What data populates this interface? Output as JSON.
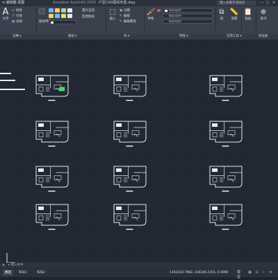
{
  "titlebar": {
    "menu": "≡  编辑器  视图",
    "app_title": "Autodesk AutoCAD 2020",
    "file_name": "户型CAD图纸布置.dwg",
    "search_placeholder": "键入关键字或短语",
    "minimize": "—",
    "maximize": "□",
    "close": "✕"
  },
  "ribbon": {
    "panels": {
      "annotation": "注释 ▾",
      "layers": "图层 ▾",
      "block": "块 ▾",
      "properties": "特性 ▾",
      "utilities": "实用工具 ▾",
      "clipboard": "剪贴板"
    },
    "text_button": "文字",
    "text_glyph": "A",
    "annotation_items": [
      "线性",
      "引线",
      "表格"
    ],
    "layers_items": [
      "图层特性",
      "置为当前",
      "匹配图层"
    ],
    "insert_button": "插入",
    "block_items": [
      "创建",
      "编辑",
      "编辑属性"
    ],
    "match_button": "特性\n匹配",
    "properties_values": {
      "color": "ByLayer",
      "linetype": "ByLayer",
      "lineweight": "ByLayer"
    },
    "group_button": "组",
    "measure_button": "测量",
    "paste_button": "粘贴",
    "base_button": "基点"
  },
  "drawing": {
    "sheets": [
      {
        "id": "a1"
      },
      {
        "id": "a2"
      },
      {
        "id": "a3"
      },
      {
        "id": "b1"
      },
      {
        "id": "b2"
      },
      {
        "id": "b3"
      },
      {
        "id": "c1"
      },
      {
        "id": "c2"
      },
      {
        "id": "c3"
      },
      {
        "id": "d1"
      },
      {
        "id": "d2"
      },
      {
        "id": "d3"
      }
    ],
    "selection_color": "#4cd964",
    "line_color": "#e8ecf2",
    "grid_color": "#2b3241"
  },
  "command_line": {
    "close_icon": "✕",
    "prompt": "▸ 键入命令"
  },
  "status": {
    "tabs": [
      "模型",
      "布局1",
      "布局2"
    ],
    "coordinates": "1162210.7982, 216246.2351, 0.0000",
    "model_label": "模型"
  },
  "colors": {
    "background": "#212733",
    "ribbon": "#3b414c",
    "accent": "#8fc7ff"
  }
}
